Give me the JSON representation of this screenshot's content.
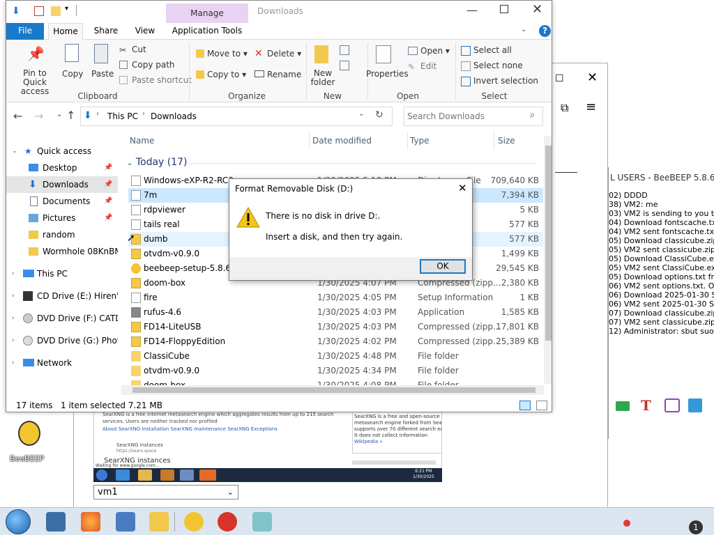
{
  "background": {
    "vm_selector": {
      "value": "vm1"
    },
    "searx": {
      "line1": "SearXNG is a free internet metasearch engine which aggregates results from up to 215 search",
      "line2": "services. Users are neither tracked nor profiled",
      "links": "About SearXNG   Installation   SearXNG maintenance   SearXNG Exceptions",
      "instances_label": "SearXNG instances",
      "instances_url": "https://searx.space",
      "instances_big": "SearXNG instances",
      "waiting": "Waiting for www.google.com...",
      "right1": "SearXNG is a free and open-source fe",
      "right2": "metasearch engine forked from Searx",
      "right3": "supports over 70 different search eng",
      "right4": "It does not collect information",
      "right5": "Wikipedia »",
      "clock_time": "6:21 PM",
      "clock_date": "1/30/2025"
    },
    "beebeep": {
      "title": "L USERS - BeeBEEP 5.8.6",
      "lines": [
        "02)      DDDD",
        "38) VM2: me",
        "03) VM2 is sending to you the f",
        "04) Download fontscache.txt fr",
        "04) VM2 sent fontscache.txt. C",
        "05) Download classicube.zip fr",
        "05) VM2 sent classicube.zip. Op",
        "05) Download ClassiCube.exe f",
        "05) VM2 sent ClassiCube.exe. C",
        "05) Download options.txt from",
        "06) VM2 sent options.txt. Open",
        "06) Download 2025-01-30 Singl",
        "06) VM2 sent 2025-01-30 Single",
        "07) Download classicube.zip fro",
        "07) VM2 sent classicube.zip. Op",
        "12) Administrator: sbut suopp s"
      ]
    },
    "desktop_icon": {
      "label": "BeeBEEP"
    },
    "taskbar_badge": "1"
  },
  "explorer": {
    "title": "Downloads",
    "manage_tab": "Manage",
    "tabs": [
      "File",
      "Home",
      "Share",
      "View",
      "Application Tools"
    ],
    "ribbon": {
      "clipboard": {
        "label": "Clipboard",
        "pin": "Pin to Quick access",
        "copy": "Copy",
        "paste": "Paste",
        "cut": "Cut",
        "copy_path": "Copy path",
        "paste_shortcut": "Paste shortcut"
      },
      "organize": {
        "label": "Organize",
        "move_to": "Move to",
        "copy_to": "Copy to",
        "delete": "Delete",
        "rename": "Rename"
      },
      "new": {
        "label": "New",
        "new_folder": "New folder"
      },
      "open": {
        "label": "Open",
        "properties": "Properties",
        "open": "Open",
        "edit": "Edit"
      },
      "select": {
        "label": "Select",
        "select_all": "Select all",
        "select_none": "Select none",
        "invert": "Invert selection"
      }
    },
    "address": {
      "path1": "This PC",
      "path2": "Downloads",
      "search_placeholder": "Search Downloads"
    },
    "nav": [
      {
        "label": "Quick access"
      },
      {
        "label": "Desktop"
      },
      {
        "label": "Downloads"
      },
      {
        "label": "Documents"
      },
      {
        "label": "Pictures"
      },
      {
        "label": "random"
      },
      {
        "label": "Wormhole 08KnBM"
      },
      {
        "label": "This PC"
      },
      {
        "label": "CD Drive (E:) Hiren's I"
      },
      {
        "label": "DVD Drive (F:) CATDIS"
      },
      {
        "label": "DVD Drive (G:) Photo"
      },
      {
        "label": "Network"
      }
    ],
    "columns": {
      "name": "Name",
      "date": "Date modified",
      "type": "Type",
      "size": "Size"
    },
    "group": "Today (17)",
    "files": [
      {
        "name": "Windows-eXP-R2-RC3",
        "date": "1/30/2025 5:18 PM",
        "type": "Disc Image File",
        "size": "709,640 KB"
      },
      {
        "name": "7m",
        "date": "",
        "type": "",
        "size": "7,394 KB"
      },
      {
        "name": "rdpviewer",
        "date": "",
        "type": "Applica",
        "size": "5 KB"
      },
      {
        "name": "tails real",
        "date": "",
        "type": "",
        "size": "577 KB"
      },
      {
        "name": "dumb",
        "date": "",
        "type": "",
        "size": "577 KB"
      },
      {
        "name": "otvdm-v0.9.0",
        "date": "",
        "type": "Comp",
        "size": "1,499 KB"
      },
      {
        "name": "beebeep-setup-5.8.6",
        "date": "",
        "type": "",
        "size": "29,545 KB"
      },
      {
        "name": "doom-box",
        "date": "1/30/2025 4:07 PM",
        "type": "Compressed (zipp...",
        "size": "2,380 KB"
      },
      {
        "name": "fire",
        "date": "1/30/2025 4:05 PM",
        "type": "Setup Information",
        "size": "1 KB"
      },
      {
        "name": "rufus-4.6",
        "date": "1/30/2025 4:03 PM",
        "type": "Application",
        "size": "1,585 KB"
      },
      {
        "name": "FD14-LiteUSB",
        "date": "1/30/2025 4:03 PM",
        "type": "Compressed (zipp...",
        "size": "17,801 KB"
      },
      {
        "name": "FD14-FloppyEdition",
        "date": "1/30/2025 4:02 PM",
        "type": "Compressed (zipp...",
        "size": "25,389 KB"
      },
      {
        "name": "ClassiCube",
        "date": "1/30/2025 4:48 PM",
        "type": "File folder",
        "size": ""
      },
      {
        "name": "otvdm-v0.9.0",
        "date": "1/30/2025 4:34 PM",
        "type": "File folder",
        "size": ""
      },
      {
        "name": "doom-box",
        "date": "1/30/2025 4:08 PM",
        "type": "File folder",
        "size": ""
      }
    ],
    "status": {
      "count": "17 items",
      "selected": "1 item selected  7.21 MB"
    }
  },
  "dialog": {
    "title": "Format Removable Disk (D:)",
    "message1": "There is no disk in drive D:.",
    "message2": "Insert a disk, and then try again.",
    "ok": "OK"
  }
}
